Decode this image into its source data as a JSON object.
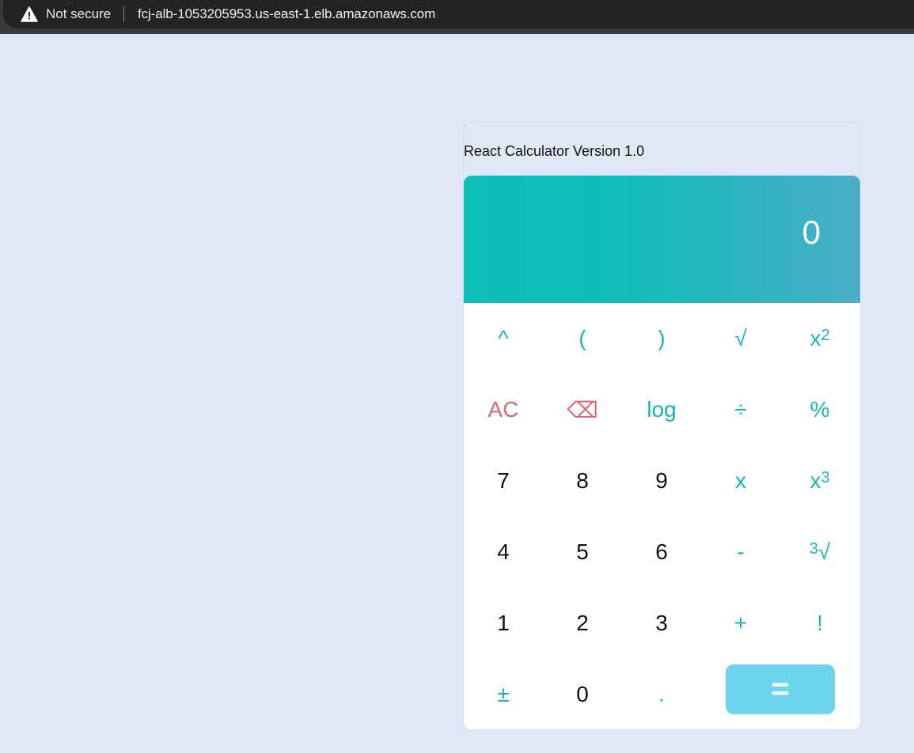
{
  "browser": {
    "security_label": "Not secure",
    "url": "fcj-alb-1053205953.us-east-1.elb.amazonaws.com"
  },
  "calculator": {
    "title": "React Calculator Version 1.0",
    "display": "0",
    "colors": {
      "accent": "#1bb5b0",
      "danger": "#d96a73",
      "equals_bg": "#6dd4ee",
      "display_bg_start": "#0cbfb8",
      "display_bg_end": "#4aaec6"
    },
    "keys": {
      "power": "^",
      "open_paren": "(",
      "close_paren": ")",
      "sqrt": "√",
      "square_base": "x",
      "square_exp": "2",
      "clear": "AC",
      "backspace": "⌫",
      "log": "log",
      "divide": "÷",
      "percent": "%",
      "seven": "7",
      "eight": "8",
      "nine": "9",
      "multiply": "x",
      "cube_base": "x",
      "cube_exp": "3",
      "four": "4",
      "five": "5",
      "six": "6",
      "minus": "-",
      "cbrt_index": "3",
      "cbrt_symbol": "√",
      "one": "1",
      "two": "2",
      "three": "3",
      "plus": "+",
      "factorial": "!",
      "plus_minus": "±",
      "zero": "0",
      "decimal": ".",
      "equals": "="
    }
  }
}
